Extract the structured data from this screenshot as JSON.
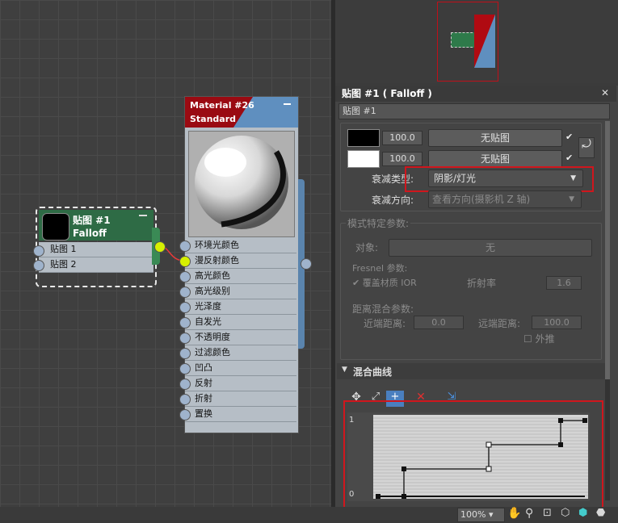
{
  "falloff_node": {
    "title": "贴图 #1",
    "subtitle": "Falloff",
    "slots": [
      "贴图 1",
      "贴图 2"
    ]
  },
  "material_node": {
    "title": "Material #26",
    "subtitle": "Standard",
    "slots": [
      "环境光颜色",
      "漫反射颜色",
      "高光颜色",
      "高光级别",
      "光泽度",
      "自发光",
      "不透明度",
      "过滤颜色",
      "凹凸",
      "反射",
      "折射",
      "置换"
    ]
  },
  "panel": {
    "window_title": "贴图 #1  ( Falloff )",
    "map_name": "贴图 #1",
    "color1_amount": "100.0",
    "color2_amount": "100.0",
    "no_map_1": "无贴图",
    "no_map_2": "无贴图",
    "falloff_type_label": "衰减类型:",
    "falloff_type_value": "阴影/灯光",
    "falloff_dir_label": "衰减方向:",
    "falloff_dir_value": "查看方向(摄影机 Z 轴)",
    "mode_params_title": "模式特定参数:",
    "object_label": "对象:",
    "object_value": "无",
    "fresnel_title": "Fresnel 参数:",
    "override_ior": "覆盖材质 IOR",
    "ior_label": "折射率",
    "ior_value": "1.6",
    "distance_title": "距离混合参数:",
    "near_label": "近端距离:",
    "near_value": "0.0",
    "far_label": "远端距离:",
    "far_value": "100.0",
    "extrapolate": "外推",
    "mix_curve_title": "混合曲线",
    "curve_y_max": "1",
    "curve_y_min": "0"
  },
  "status": {
    "zoom": "100%"
  },
  "colors": {
    "accent_red": "#d0161d",
    "node_green": "#2e6b45",
    "material_red": "#9a0a12",
    "material_blue": "#5f8fbf"
  }
}
